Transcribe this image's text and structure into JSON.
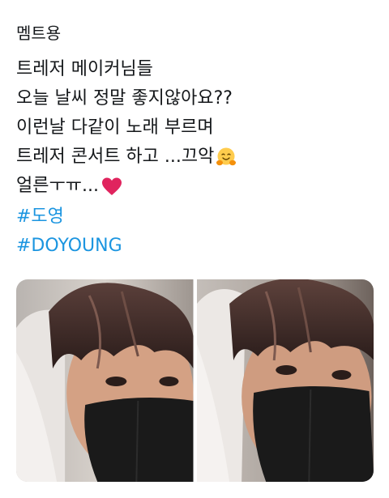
{
  "tweet": {
    "header": "멤트용",
    "lines": [
      "트레저 메이커님들",
      "오늘 날씨 정말 좋지않아요??",
      "이런날 다같이 노래 부르며",
      "트레저 콘서트 하고 ...끄악",
      "얼른ㅜㅠ..."
    ],
    "hashtags": [
      "#도영",
      "#DOYOUNG"
    ],
    "emojis": {
      "line4": "hugging-face-emoji",
      "line5": "red-heart-emoji"
    },
    "colors": {
      "text": "#14171a",
      "hashtag": "#1b95e0",
      "heart": "#e0245e",
      "hug": "#ffcc4d"
    },
    "media_count": 2
  }
}
